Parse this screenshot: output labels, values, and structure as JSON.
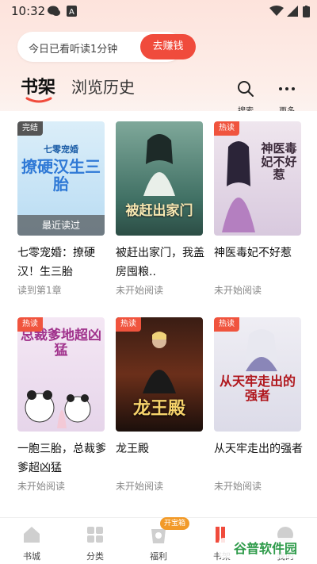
{
  "status_bar": {
    "time": "10:32"
  },
  "listen_chip": {
    "text": "今日已看听读1分钟",
    "button": "去赚钱"
  },
  "tabs": {
    "active": "书架",
    "other": "浏览历史"
  },
  "toolbar": {
    "search_label": "搜索",
    "more_label": "更多"
  },
  "books": [
    {
      "title": "七零宠婚：撩硬汉！生三胎",
      "status": "读到第1章",
      "badge": "完结",
      "cover_text": "撩硬汉生三胎",
      "cover_tag": "七零宠婚",
      "overlay": "最近读过"
    },
    {
      "title": "被赶出家门，我盖房囤粮..",
      "status": "未开始阅读",
      "badge": "",
      "cover_text": "被赶出家门"
    },
    {
      "title": "神医毒妃不好惹",
      "status": "未开始阅读",
      "badge": "热读",
      "cover_text": "神医毒妃不好惹"
    },
    {
      "title": "一胞三胎，总裁爹爹超凶猛",
      "status": "未开始阅读",
      "badge": "热读",
      "cover_text": "总裁爹地超凶猛"
    },
    {
      "title": "龙王殿",
      "status": "未开始阅读",
      "badge": "热读",
      "cover_text": "龙王殿"
    },
    {
      "title": "从天牢走出的强者",
      "status": "未开始阅读",
      "badge": "热读",
      "cover_text": "从天牢走出的强者"
    }
  ],
  "nav": {
    "items": [
      "书城",
      "分类",
      "福利",
      "书架",
      "我的"
    ],
    "welfare_badge": "开宝箱"
  },
  "watermark": "谷普软件园",
  "colors": {
    "accent": "#f04b3c",
    "badge_hot": "#f0543e",
    "badge_done": "#555555"
  }
}
